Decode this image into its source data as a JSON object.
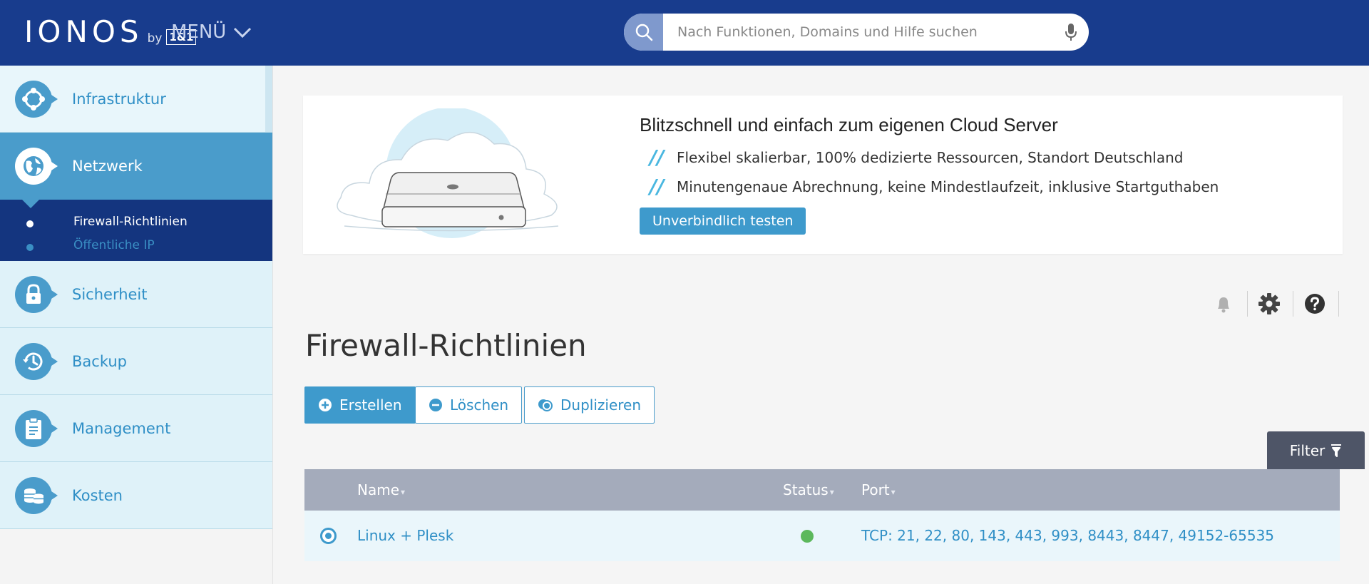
{
  "header": {
    "logo_main": "IONOS",
    "logo_by": "by",
    "logo_box": "1&1",
    "menu_label": "MENÜ",
    "search_placeholder": "Nach Funktionen, Domains und Hilfe suchen"
  },
  "sidebar": {
    "items": [
      {
        "label": "Infrastruktur",
        "icon": "infrastructure-icon"
      },
      {
        "label": "Netzwerk",
        "icon": "network-globe-icon",
        "active": true
      },
      {
        "label": "Sicherheit",
        "icon": "lock-icon"
      },
      {
        "label": "Backup",
        "icon": "history-clock-icon"
      },
      {
        "label": "Management",
        "icon": "clipboard-icon"
      },
      {
        "label": "Kosten",
        "icon": "coins-icon"
      }
    ],
    "subitems": [
      {
        "label": "Firewall-Richtlinien",
        "active": true
      },
      {
        "label": "Öffentliche IP",
        "active": false
      }
    ]
  },
  "banner": {
    "title": "Blitzschnell und einfach zum eigenen Cloud Server",
    "tick": "//",
    "bullets": [
      "Flexibel skalierbar, 100% dedizierte Ressourcen, Standort Deutschland",
      "Minutengenaue Abrechnung, keine Mindestlaufzeit, inklusive Startguthaben"
    ],
    "cta_label": "Unverbindlich testen"
  },
  "page": {
    "title": "Firewall-Richtlinien",
    "actions": {
      "create": "Erstellen",
      "delete": "Löschen",
      "duplicate": "Duplizieren"
    },
    "filter_label": "Filter"
  },
  "table": {
    "columns": {
      "name": "Name",
      "status": "Status",
      "port": "Port"
    },
    "caret": "▾",
    "rows": [
      {
        "name": "Linux + Plesk",
        "status_color": "#5cb85c",
        "port": "TCP: 21, 22, 80, 143, 443, 993, 8443, 8447, 49152-65535"
      }
    ]
  },
  "colors": {
    "header_bg": "#183c8d",
    "accent": "#3e9acc",
    "submenu_bg": "#14357f",
    "status_ok": "#5cb85c"
  }
}
